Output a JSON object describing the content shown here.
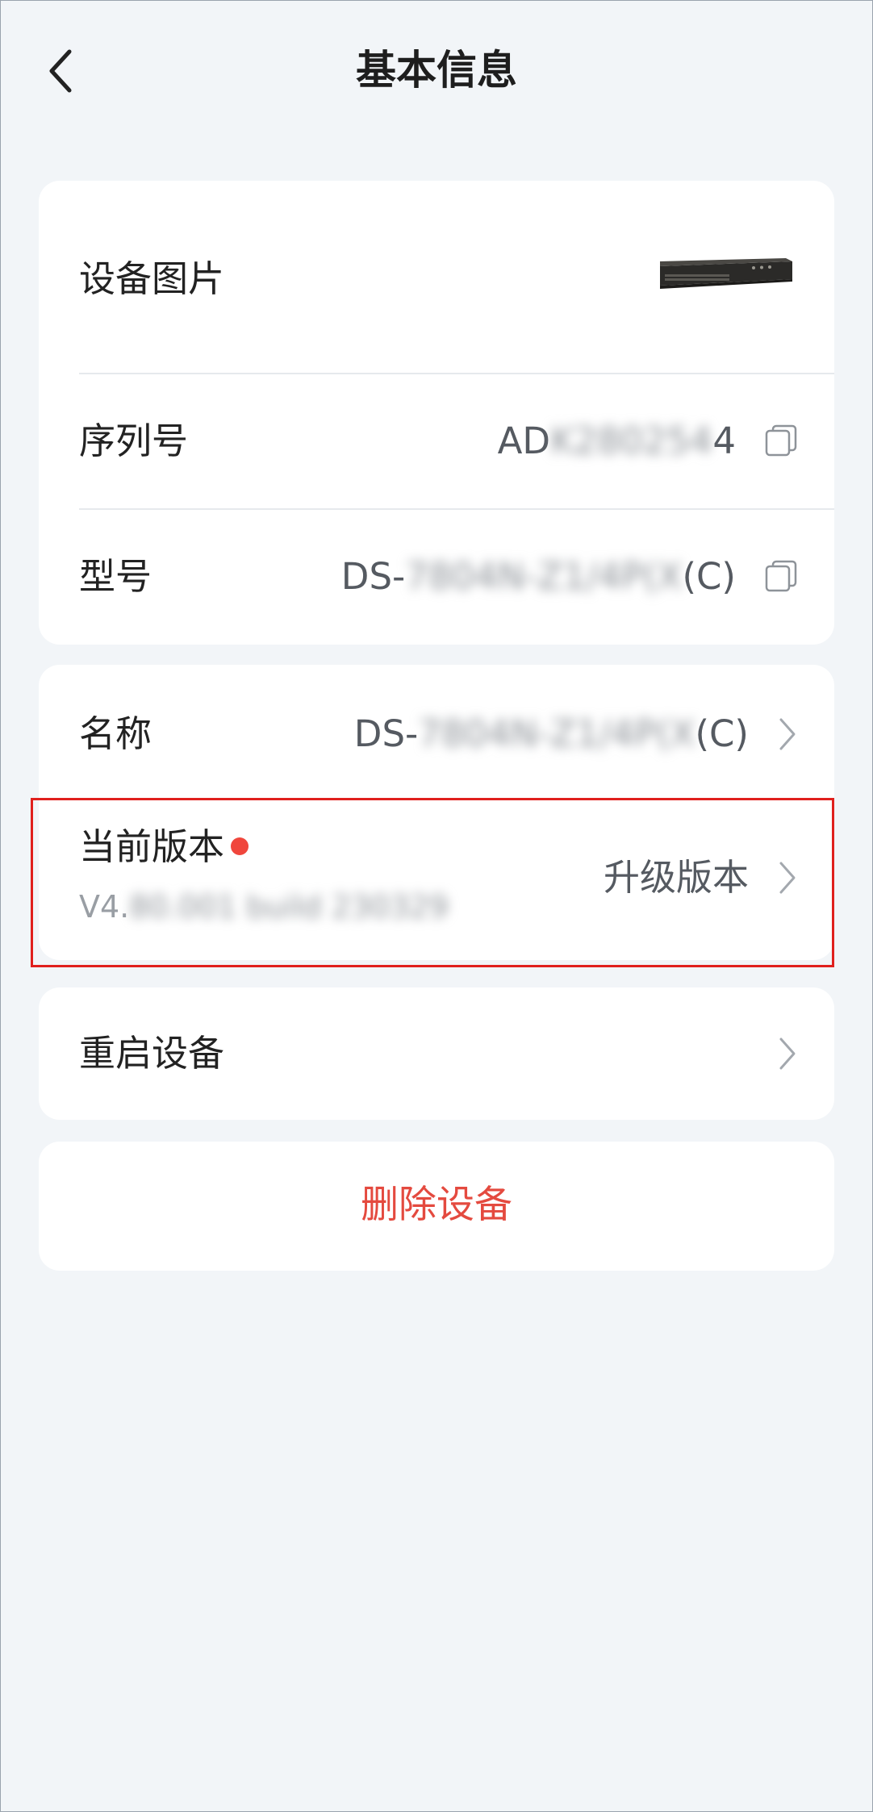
{
  "header": {
    "title": "基本信息",
    "back_icon": "chevron-left-icon"
  },
  "device_card": {
    "image_label": "设备图片",
    "serial_label": "序列号",
    "serial_prefix": "AD",
    "serial_blurred": "K280254",
    "serial_suffix": "4",
    "model_label": "型号",
    "model_prefix": "DS-",
    "model_blurred": "7804N-Z1/4P(X",
    "model_suffix": "(C)"
  },
  "info_card": {
    "name_label": "名称",
    "name_prefix": "DS-",
    "name_blurred": "7804N-Z1/4P(X",
    "name_suffix": "(C)",
    "version_label": "当前版本",
    "version_prefix": "V4.",
    "version_blurred": "80.001 build 230329",
    "upgrade_label": "升级版本"
  },
  "reboot": {
    "label": "重启设备"
  },
  "delete": {
    "label": "删除设备"
  },
  "colors": {
    "accent_red": "#e44a3f",
    "notification_dot": "#f0463c",
    "highlight_box": "#e0201d",
    "background": "#f2f5f8"
  }
}
